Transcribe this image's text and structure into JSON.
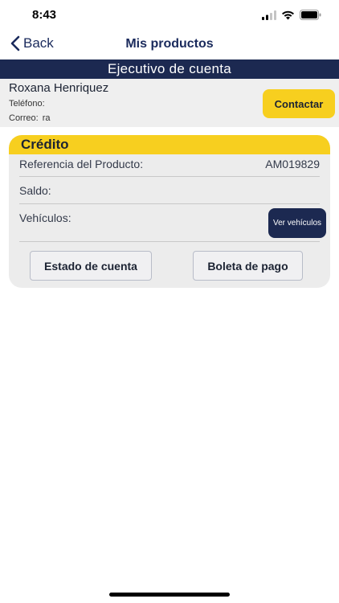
{
  "status": {
    "time": "8:43"
  },
  "nav": {
    "back_label": "Back",
    "title": "Mis productos"
  },
  "executive": {
    "header": "Ejecutivo de cuenta",
    "name": "Roxana Henriquez",
    "phone_label": "Teléfono:",
    "email_label": "Correo:",
    "email_value": "ra",
    "contact_button": "Contactar"
  },
  "credit": {
    "title": "Crédito",
    "reference_label": "Referencia del Producto:",
    "reference_value": "AM019829",
    "balance_label": "Saldo:",
    "vehicles_label": "Vehículos:",
    "vehicles_button": "Ver vehículos",
    "statement_button": "Estado de cuenta",
    "payment_button": "Boleta de pago"
  },
  "colors": {
    "navy": "#1c2951",
    "yellow": "#f7cf1f"
  }
}
